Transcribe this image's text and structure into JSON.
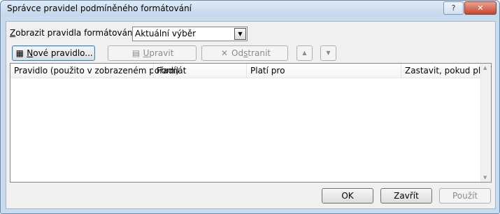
{
  "window": {
    "title": "Správce pravidel podmíněného formátování",
    "help_label": "?",
    "close_label": "✕"
  },
  "show_rules": {
    "label_prefix": "Z",
    "label_rest": "obrazit pravidla formátování pro:",
    "value": "Aktuální výběr"
  },
  "toolbar": {
    "new_rule_prefix": "N",
    "new_rule_rest": "ové pravidlo...",
    "edit_rule_prefix": "U",
    "edit_rule_rest": "pravit pravidlo...",
    "delete_rule_pre": "Od",
    "delete_rule_ul": "s",
    "delete_rule_post": "tranit pravidlo",
    "move_up": "▲",
    "move_down": "▼"
  },
  "list": {
    "columns": [
      "Pravidlo (použito v zobrazeném pořadí)",
      "Formát",
      "Platí pro",
      "Zastavit, pokud platí"
    ],
    "rows": []
  },
  "footer": {
    "ok": "OK",
    "close": "Zavřít",
    "apply": "Použít"
  },
  "icons": {
    "new_rule": "table-new-icon",
    "edit_rule": "table-edit-icon",
    "delete_rule": "x-delete-icon"
  }
}
